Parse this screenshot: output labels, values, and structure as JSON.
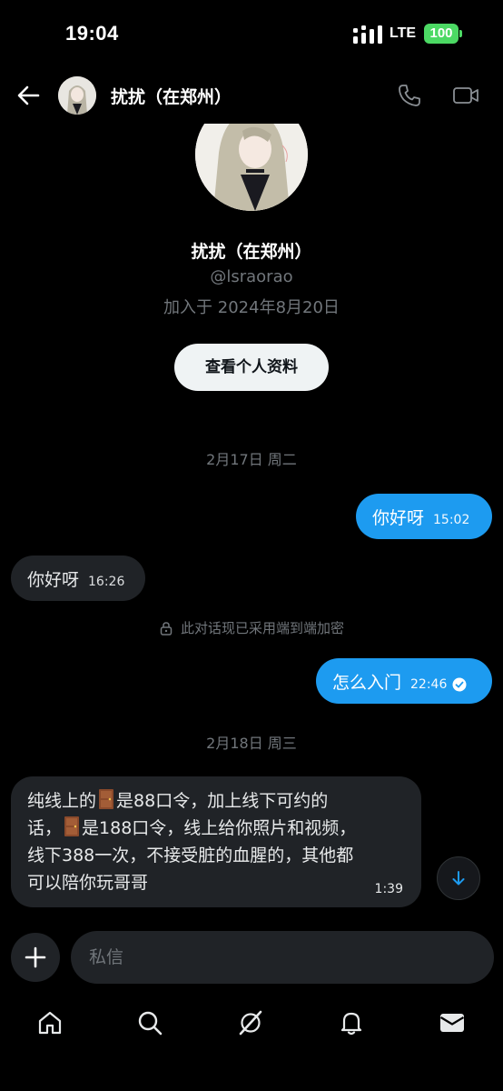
{
  "status_bar": {
    "time": "19:04",
    "network": "LTE",
    "battery": "100"
  },
  "header": {
    "name": "扰扰（在郑州）"
  },
  "profile": {
    "name": "扰扰（在郑州）",
    "handle": "@lsraorao",
    "joined": "加入于 2024年8月20日",
    "view_profile_label": "查看个人资料"
  },
  "conversation": {
    "date_1": "2月17日 周二",
    "msg_1": {
      "text": "你好呀",
      "time": "15:02"
    },
    "msg_2": {
      "text": "你好呀",
      "time": "16:26"
    },
    "encryption_notice": "此对话现已采用端到端加密",
    "msg_3": {
      "text": "怎么入门",
      "time": "22:46"
    },
    "date_2": "2月18日 周三",
    "msg_4": {
      "line_1a": "纯线上的",
      "line_1b": "是88口令，加上线下可约的",
      "line_2a": "话，",
      "line_2b": "是188口令，线上给你照片和视频，",
      "line_3": "线下388一次，不接受脏的血腥的，其他都",
      "line_4": "可以陪你玩哥哥",
      "time": "1:39"
    }
  },
  "composer": {
    "placeholder": "私信"
  },
  "nav": {
    "items": [
      "home-icon",
      "search-icon",
      "grok-icon",
      "notifications-icon",
      "messages-icon"
    ]
  },
  "colors": {
    "accent": "#1d9bf0",
    "bubble_received": "#202327",
    "background": "#000000",
    "battery": "#4cd964"
  }
}
